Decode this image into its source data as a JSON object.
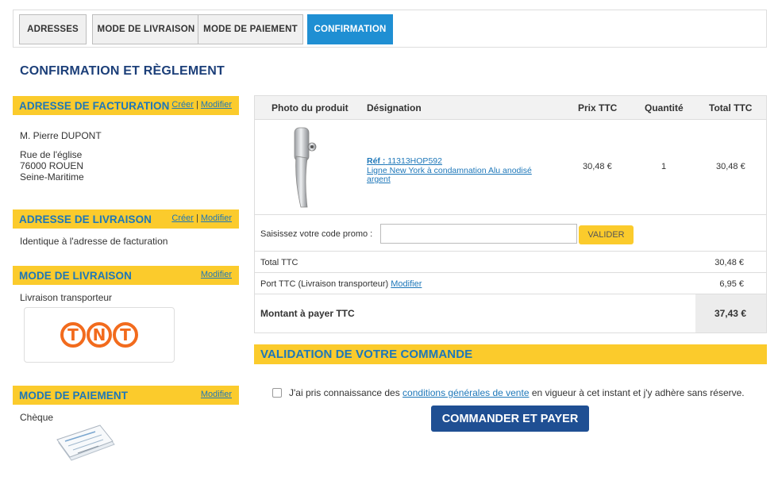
{
  "steps": [
    {
      "label": "ADRESSES",
      "active": false
    },
    {
      "label": "MODE DE LIVRAISON",
      "active": false
    },
    {
      "label": "MODE DE PAIEMENT",
      "active": false
    },
    {
      "label": "CONFIRMATION",
      "active": true
    }
  ],
  "page_title": "CONFIRMATION ET RÈGLEMENT",
  "billing": {
    "title": "ADRESSE DE FACTURATION",
    "create_link": "Créer",
    "separator": "|",
    "modify_link": "Modifier",
    "name": "M. Pierre DUPONT",
    "street": "Rue de l'église",
    "city": "76000 ROUEN",
    "region": "Seine-Maritime"
  },
  "shipping_address": {
    "title": "ADRESSE DE LIVRAISON",
    "create_link": "Créer",
    "separator": "|",
    "modify_link": "Modifier",
    "text": "Identique à l'adresse de facturation"
  },
  "shipping_mode": {
    "title": "MODE DE LIVRAISON",
    "modify_link": "Modifier",
    "text": "Livraison transporteur",
    "logo_letters": [
      "T",
      "N",
      "T"
    ]
  },
  "payment_mode": {
    "title": "MODE DE PAIEMENT",
    "modify_link": "Modifier",
    "text": "Chèque"
  },
  "table": {
    "headers": {
      "photo": "Photo du produit",
      "designation": "Désignation",
      "price": "Prix TTC",
      "quantity": "Quantité",
      "total": "Total TTC"
    },
    "product": {
      "ref_label": "Réf :",
      "ref": "11313HOP592",
      "name": "Ligne New York à condamnation Alu anodisé argent",
      "price": "30,48 €",
      "quantity": "1",
      "total": "30,48 €"
    },
    "promo": {
      "label": "Saisissez votre code promo :",
      "value": "",
      "button": "VALIDER"
    },
    "total_ttc": {
      "label": "Total TTC",
      "value": "30,48 €"
    },
    "shipping": {
      "label": "Port TTC (Livraison transporteur)",
      "link": "Modifier",
      "value": "6,95 €"
    },
    "amount_due": {
      "label": "Montant à payer TTC",
      "value": "37,43 €"
    }
  },
  "validation": {
    "title": "VALIDATION DE VOTRE COMMANDE",
    "cgv_before": "J'ai pris connaissance des",
    "cgv_link": "conditions générales de vente",
    "cgv_after": "en vigueur à cet instant et j'y adhère sans réserve.",
    "checked": false,
    "order_button": "COMMANDER ET PAYER"
  },
  "colors": {
    "accent_yellow": "#fbcb2c",
    "link_blue": "#1d77b9",
    "active_step": "#1f8fd3",
    "order_button": "#1f4f93",
    "tnt_orange": "#f26b1d"
  }
}
